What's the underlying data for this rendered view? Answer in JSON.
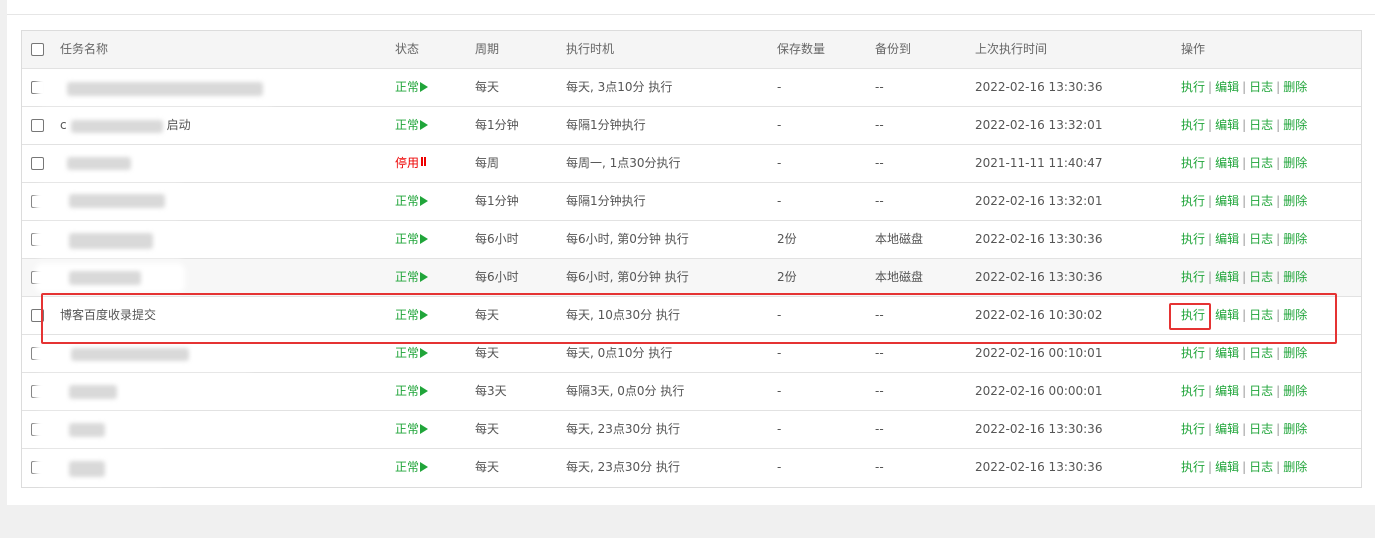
{
  "header": {
    "name": "任务名称",
    "status": "状态",
    "cycle": "周期",
    "exec": "执行时机",
    "keep": "保存数量",
    "backup": "备份到",
    "last": "上次执行时间",
    "ops": "操作"
  },
  "ops": {
    "run": "执行",
    "edit": "编辑",
    "log": "日志",
    "delete": "删除",
    "separator": "|"
  },
  "rows": [
    {
      "name": "",
      "status": "正常",
      "cycle": "每天",
      "exec": "每天, 3点10分 执行",
      "keep": "-",
      "backup": "--",
      "last": "2022-02-16 13:30:36"
    },
    {
      "name": "c",
      "name_suffix": "启动",
      "status": "正常",
      "cycle": "每1分钟",
      "exec": "每隔1分钟执行",
      "keep": "-",
      "backup": "--",
      "last": "2022-02-16 13:32:01"
    },
    {
      "name": "",
      "status": "停用",
      "cycle": "每周",
      "exec": "每周一, 1点30分执行",
      "keep": "-",
      "backup": "--",
      "last": "2021-11-11 11:40:47"
    },
    {
      "name": "",
      "status": "正常",
      "cycle": "每1分钟",
      "exec": "每隔1分钟执行",
      "keep": "-",
      "backup": "--",
      "last": "2022-02-16 13:32:01"
    },
    {
      "name": "",
      "status": "正常",
      "cycle": "每6小时",
      "exec": "每6小时, 第0分钟 执行",
      "keep": "2份",
      "backup": "本地磁盘",
      "last": "2022-02-16 13:30:36"
    },
    {
      "name": "",
      "status": "正常",
      "cycle": "每6小时",
      "exec": "每6小时, 第0分钟 执行",
      "keep": "2份",
      "backup": "本地磁盘",
      "last": "2022-02-16 13:30:36"
    },
    {
      "name": "博客百度收录提交",
      "status": "正常",
      "cycle": "每天",
      "exec": "每天, 10点30分 执行",
      "keep": "-",
      "backup": "--",
      "last": "2022-02-16 10:30:02"
    },
    {
      "name": "",
      "status": "正常",
      "cycle": "每天",
      "exec": "每天, 0点10分 执行",
      "keep": "-",
      "backup": "--",
      "last": "2022-02-16 00:10:01"
    },
    {
      "name": "",
      "status": "正常",
      "cycle": "每3天",
      "exec": "每隔3天, 0点0分 执行",
      "keep": "-",
      "backup": "--",
      "last": "2022-02-16 00:00:01"
    },
    {
      "name": "",
      "status": "正常",
      "cycle": "每天",
      "exec": "每天, 23点30分 执行",
      "keep": "-",
      "backup": "--",
      "last": "2022-02-16 13:30:36"
    },
    {
      "name": "",
      "status": "正常",
      "cycle": "每天",
      "exec": "每天, 23点30分 执行",
      "keep": "-",
      "backup": "--",
      "last": "2022-02-16 13:30:36"
    }
  ],
  "colors": {
    "green": "#20a53a",
    "red": "#e00000",
    "highlight": "#e53333"
  }
}
